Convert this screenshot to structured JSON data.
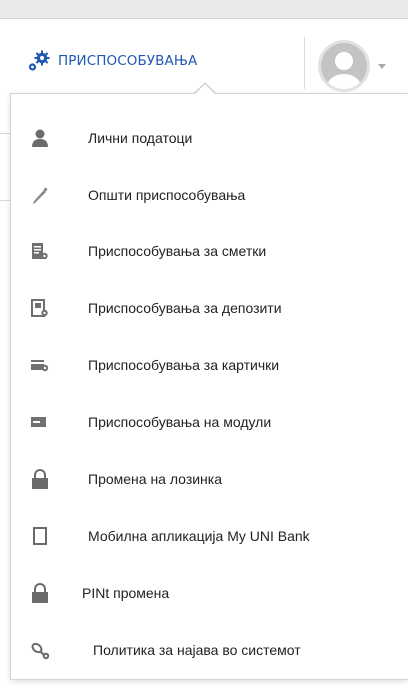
{
  "header": {
    "settings_label": "ПРИСПОСОБУВАЊА",
    "settings_icon": "gears-icon",
    "user_icon": "user-avatar-icon",
    "accent_color": "#1f57b4"
  },
  "menu": {
    "items": [
      {
        "label": "Лични податоци",
        "icon": "person-icon"
      },
      {
        "label": "Општи приспособувања",
        "icon": "pencil-icon"
      },
      {
        "label": "Приспособувања за сметки",
        "icon": "account-settings-icon"
      },
      {
        "label": "Приспособувања за депозити",
        "icon": "deposit-settings-icon"
      },
      {
        "label": "Приспособувања за картички",
        "icon": "card-settings-icon"
      },
      {
        "label": "Приспособувања на модули",
        "icon": "module-icon"
      },
      {
        "label": "Промена на лозинка",
        "icon": "lock-icon"
      },
      {
        "label": "Мобилна апликација My UNI Bank",
        "icon": "mobile-icon"
      },
      {
        "label": "PINt промена",
        "icon": "lock-icon"
      },
      {
        "label": "Политика за најава во системот",
        "icon": "login-policy-icon"
      }
    ]
  }
}
